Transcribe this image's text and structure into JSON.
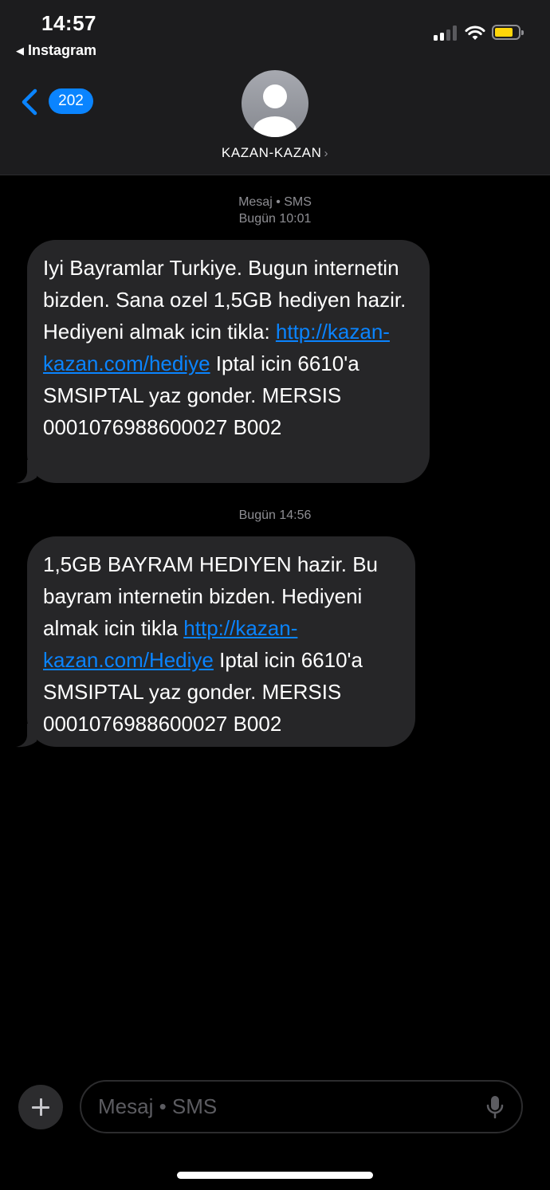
{
  "status_bar": {
    "time": "14:57",
    "back_app": "Instagram"
  },
  "header": {
    "unread_count": "202",
    "contact_name": "KAZAN-KAZAN",
    "chevron": "›"
  },
  "messages": [
    {
      "meta_line1": "Mesaj • SMS",
      "meta_line2": "Bugün 10:01",
      "text_before": "Iyi Bayramlar Turkiye. Bugun internetin bizden. Sana ozel 1,5GB hediyen hazir. Hediyeni almak icin tikla: ",
      "link": "http://kazan-kazan.com/hediye",
      "text_after": " Iptal icin 6610'a SMSIPTAL yaz gonder. MERSIS 0001076988600027 B002"
    },
    {
      "meta_line1": "Bugün 14:56",
      "text_before": "1,5GB BAYRAM HEDIYEN hazir. Bu bayram internetin bizden. Hediyeni almak icin tikla ",
      "link": "http://kazan-kazan.com/Hediye",
      "text_after": " Iptal icin 6610'a SMSIPTAL yaz gonder. MERSIS 0001076988600027 B002"
    }
  ],
  "composer": {
    "placeholder": "Mesaj • SMS"
  },
  "icons": {
    "back": "chevron-left-icon",
    "avatar": "person-icon",
    "add": "plus-icon",
    "mic": "microphone-icon",
    "signal": "cellular-signal-icon",
    "wifi": "wifi-icon",
    "battery": "battery-icon"
  },
  "colors": {
    "accent": "#0a84ff",
    "bubble": "#262628",
    "header_bg": "#1c1c1e",
    "battery_fill": "#ffd60a"
  }
}
